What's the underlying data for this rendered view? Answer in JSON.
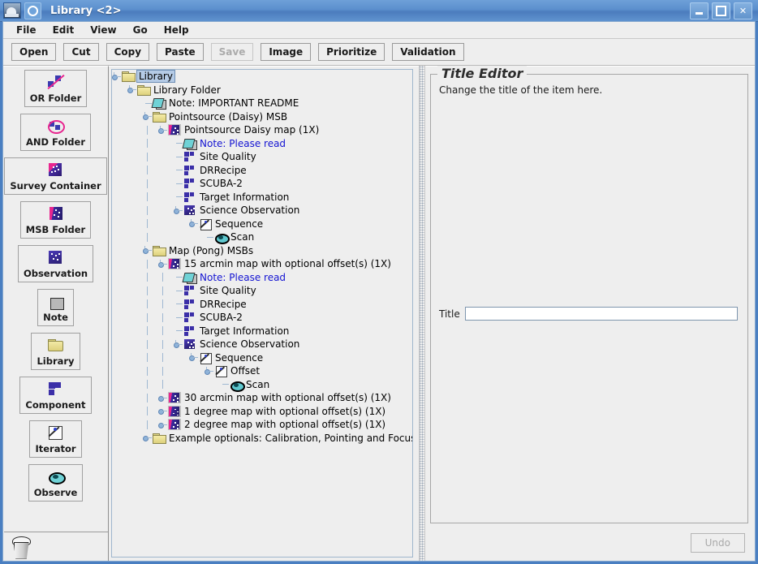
{
  "window": {
    "title": "Library <2>",
    "app_icon": "telescope-icon",
    "controls": {
      "minimize": "minimize-icon",
      "maximize": "maximize-icon",
      "close": "✕"
    }
  },
  "menubar": {
    "items": [
      "File",
      "Edit",
      "View",
      "Go",
      "Help"
    ]
  },
  "toolbar": {
    "buttons": [
      {
        "label": "Open",
        "enabled": true
      },
      {
        "label": "Cut",
        "enabled": true
      },
      {
        "label": "Copy",
        "enabled": true
      },
      {
        "label": "Paste",
        "enabled": true
      },
      {
        "label": "Save",
        "enabled": false
      },
      {
        "label": "Image",
        "enabled": true
      },
      {
        "label": "Prioritize",
        "enabled": true
      },
      {
        "label": "Validation",
        "enabled": true
      }
    ]
  },
  "palette": {
    "items": [
      {
        "label": "OR Folder",
        "icon": "or-folder-icon"
      },
      {
        "label": "AND Folder",
        "icon": "and-folder-icon"
      },
      {
        "label": "Survey Container",
        "icon": "survey-container-icon"
      },
      {
        "label": "MSB Folder",
        "icon": "msb-folder-icon"
      },
      {
        "label": "Observation",
        "icon": "observation-icon"
      },
      {
        "label": "Note",
        "icon": "note-icon"
      },
      {
        "label": "Library",
        "icon": "library-folder-icon"
      },
      {
        "label": "Component",
        "icon": "component-icon"
      },
      {
        "label": "Iterator",
        "icon": "iterator-icon"
      },
      {
        "label": "Observe",
        "icon": "observe-eye-icon"
      }
    ],
    "trash": "trash-icon"
  },
  "tree": {
    "nodes": [
      {
        "label": "Library",
        "icon": "folder-icon",
        "depth": 0,
        "handle": "expanded",
        "selected": true,
        "style": "normal"
      },
      {
        "label": "Library Folder",
        "icon": "folder-icon",
        "depth": 1,
        "handle": "expanded",
        "selected": false,
        "style": "normal"
      },
      {
        "label": "Note: IMPORTANT README",
        "icon": "note-icon",
        "depth": 2,
        "handle": "leaf",
        "selected": false,
        "style": "normal"
      },
      {
        "label": "Pointsource (Daisy)  MSB",
        "icon": "folder-icon",
        "depth": 2,
        "handle": "expanded",
        "selected": false,
        "style": "normal"
      },
      {
        "label": "Pointsource Daisy map (1X)",
        "icon": "msb-icon",
        "depth": 3,
        "handle": "expanded",
        "selected": false,
        "style": "normal"
      },
      {
        "label": "Note: Please read",
        "icon": "note-icon",
        "depth": 4,
        "handle": "leaf",
        "selected": false,
        "style": "note"
      },
      {
        "label": "Site Quality",
        "icon": "component-icon",
        "depth": 4,
        "handle": "leaf",
        "selected": false,
        "style": "normal"
      },
      {
        "label": "DRRecipe",
        "icon": "component-icon",
        "depth": 4,
        "handle": "leaf",
        "selected": false,
        "style": "normal"
      },
      {
        "label": "SCUBA-2",
        "icon": "component-icon",
        "depth": 4,
        "handle": "leaf",
        "selected": false,
        "style": "normal"
      },
      {
        "label": "Target Information",
        "icon": "component-icon",
        "depth": 4,
        "handle": "leaf",
        "selected": false,
        "style": "normal"
      },
      {
        "label": "Science Observation",
        "icon": "observation-icon",
        "depth": 4,
        "handle": "expanded",
        "selected": false,
        "style": "normal"
      },
      {
        "label": "Sequence",
        "icon": "iterator-icon",
        "depth": 5,
        "handle": "expanded",
        "selected": false,
        "style": "normal"
      },
      {
        "label": "Scan",
        "icon": "observe-eye-icon",
        "depth": 6,
        "handle": "leaf",
        "selected": false,
        "style": "normal"
      },
      {
        "label": "Map (Pong)  MSBs",
        "icon": "folder-icon",
        "depth": 2,
        "handle": "expanded",
        "selected": false,
        "style": "normal"
      },
      {
        "label": "15 arcmin map with optional offset(s) (1X)",
        "icon": "msb-icon",
        "depth": 3,
        "handle": "expanded",
        "selected": false,
        "style": "normal"
      },
      {
        "label": "Note: Please read",
        "icon": "note-icon",
        "depth": 4,
        "handle": "leaf",
        "selected": false,
        "style": "note"
      },
      {
        "label": "Site Quality",
        "icon": "component-icon",
        "depth": 4,
        "handle": "leaf",
        "selected": false,
        "style": "normal"
      },
      {
        "label": "DRRecipe",
        "icon": "component-icon",
        "depth": 4,
        "handle": "leaf",
        "selected": false,
        "style": "normal"
      },
      {
        "label": "SCUBA-2",
        "icon": "component-icon",
        "depth": 4,
        "handle": "leaf",
        "selected": false,
        "style": "normal"
      },
      {
        "label": "Target Information",
        "icon": "component-icon",
        "depth": 4,
        "handle": "leaf",
        "selected": false,
        "style": "normal"
      },
      {
        "label": "Science Observation",
        "icon": "observation-icon",
        "depth": 4,
        "handle": "expanded",
        "selected": false,
        "style": "normal"
      },
      {
        "label": "Sequence",
        "icon": "iterator-icon",
        "depth": 5,
        "handle": "expanded",
        "selected": false,
        "style": "normal"
      },
      {
        "label": "Offset",
        "icon": "iterator-icon",
        "depth": 6,
        "handle": "expanded",
        "selected": false,
        "style": "normal"
      },
      {
        "label": "Scan",
        "icon": "observe-eye-icon",
        "depth": 7,
        "handle": "leaf",
        "selected": false,
        "style": "normal"
      },
      {
        "label": "30 arcmin map with optional offset(s) (1X)",
        "icon": "msb-icon",
        "depth": 3,
        "handle": "collapsed",
        "selected": false,
        "style": "normal"
      },
      {
        "label": "1 degree map with optional offset(s) (1X)",
        "icon": "msb-icon",
        "depth": 3,
        "handle": "collapsed",
        "selected": false,
        "style": "normal"
      },
      {
        "label": "2 degree map with optional offset(s) (1X)",
        "icon": "msb-icon",
        "depth": 3,
        "handle": "collapsed",
        "selected": false,
        "style": "normal"
      },
      {
        "label": "Example optionals: Calibration, Pointing and Focus",
        "icon": "folder-icon",
        "depth": 2,
        "handle": "collapsed",
        "selected": false,
        "style": "normal"
      }
    ]
  },
  "editor": {
    "legend": "Title Editor",
    "description": "Change the title of the item here.",
    "title_label": "Title",
    "title_value": "",
    "title_placeholder": "",
    "undo_label": "Undo",
    "undo_enabled": false
  },
  "colors": {
    "titlebar": "#5b8fcd",
    "panel": "#eeeeee",
    "selection": "#b5cbe6",
    "note_text": "#1414d2",
    "tree_line": "#9fb8d2"
  }
}
